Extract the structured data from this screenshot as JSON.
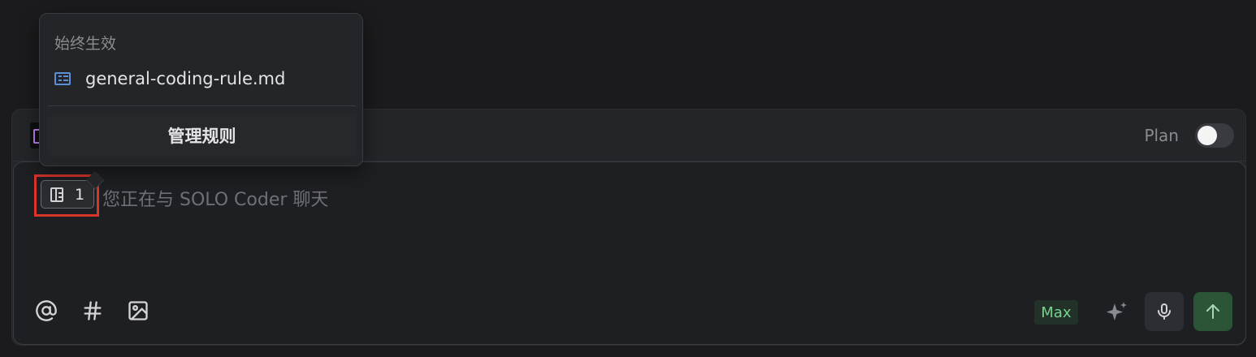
{
  "popup": {
    "section_title": "始终生效",
    "rule_file": "general-coding-rule.md",
    "manage_label": "管理规则"
  },
  "header": {
    "plan_label": "Plan",
    "plan_enabled": false
  },
  "input": {
    "rule_count": "1",
    "placeholder": "您正在与 SOLO Coder 聊天"
  },
  "toolbar": {
    "mention_icon": "at-icon",
    "hash_icon": "hash-icon",
    "image_icon": "image-icon",
    "max_label": "Max",
    "sparkle_icon": "sparkle-icon",
    "mic_icon": "mic-icon",
    "send_icon": "arrow-up-icon"
  },
  "colors": {
    "highlight": "#d9352b",
    "max_text": "#79d28f",
    "send_bg": "#2c5537",
    "file_icon": "#5b8fd8"
  }
}
